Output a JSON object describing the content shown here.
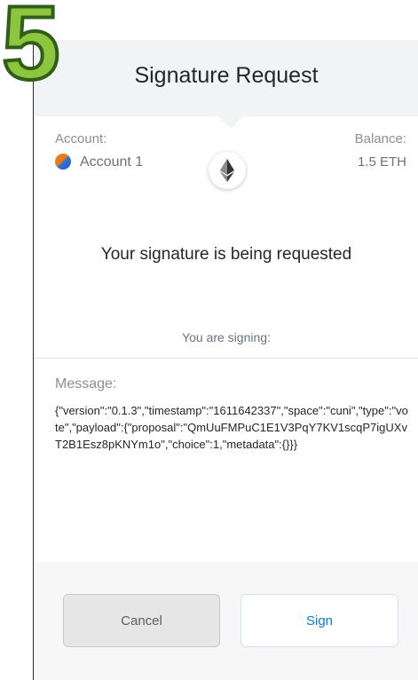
{
  "step_number": "5",
  "header": {
    "title": "Signature Request"
  },
  "account": {
    "label": "Account:",
    "name": "Account 1",
    "balance_label": "Balance:",
    "balance_value": "1.5 ETH"
  },
  "network_icon": "ethereum-icon",
  "request_text": "Your signature is being requested",
  "signing_label": "You are signing:",
  "message": {
    "label": "Message:",
    "body": "{\"version\":\"0.1.3\",\"timestamp\":\"1611642337\",\"space\":\"cuni\",\"type\":\"vote\",\"payload\":{\"proposal\":\"QmUuFMPuC1E1V3PqY7KV1scqP7igUXvT2B1Esz8pKNYm1o\",\"choice\":1,\"metadata\":{}}}"
  },
  "buttons": {
    "cancel": "Cancel",
    "sign": "Sign"
  },
  "colors": {
    "step_fill": "#8cc63f",
    "sign_text": "#037dd6",
    "header_bg": "#f2f3f4"
  }
}
